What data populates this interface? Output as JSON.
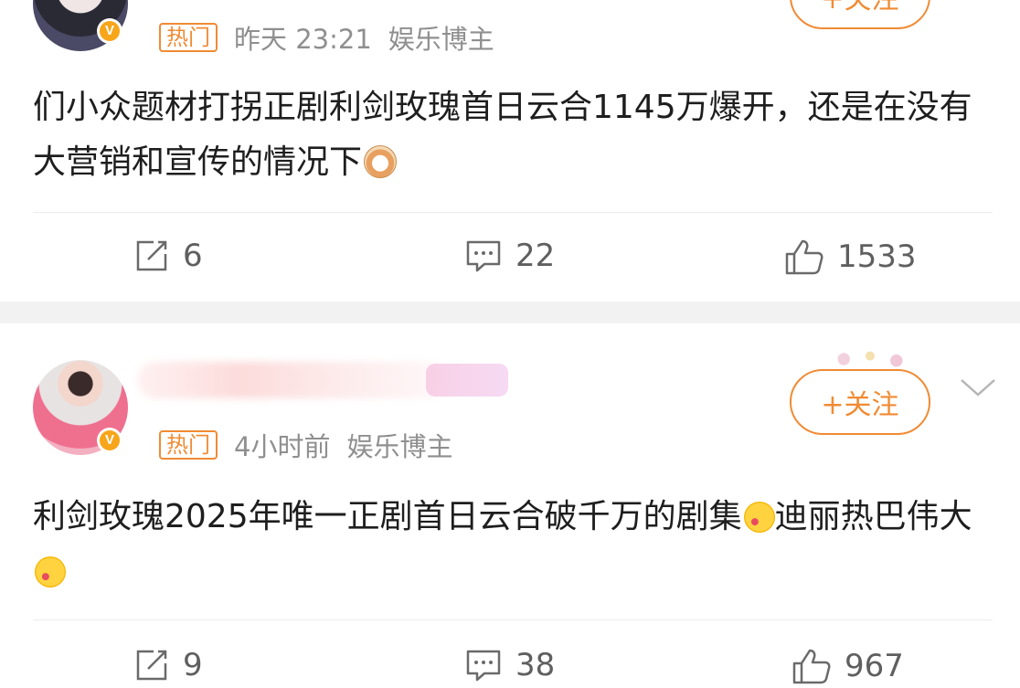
{
  "post1": {
    "hot_tag": "热门",
    "time": "昨天 23:21",
    "category": "娱乐博主",
    "follow_label": "+关注",
    "content": "们小众题材打拐正剧利剑玫瑰首日云合1145万爆开，还是在没有大营销和宣传的情况下",
    "actions": {
      "repost": "6",
      "comment": "22",
      "like": "1533"
    }
  },
  "post2": {
    "hot_tag": "热门",
    "time": "4小时前",
    "category": "娱乐博主",
    "follow_label": "+关注",
    "content_part1": "利剑玫瑰2025年唯一正剧首日云合破千万的剧集",
    "content_part2": "迪丽热巴伟大",
    "actions": {
      "repost": "9",
      "comment": "38",
      "like": "967"
    }
  },
  "icons": {
    "verified_badge": "v-badge-icon",
    "repost": "repost-icon",
    "comment": "comment-icon",
    "like": "thumbs-up-icon",
    "more": "chevron-down-icon",
    "emoji_cat": "cat-emoji",
    "emoji_kiss": "kiss-emoji"
  },
  "colors": {
    "accent": "#f08b34",
    "meta_text": "#8f8f8f",
    "separator": "#f2f2f2",
    "badge": "#f7a51a"
  }
}
